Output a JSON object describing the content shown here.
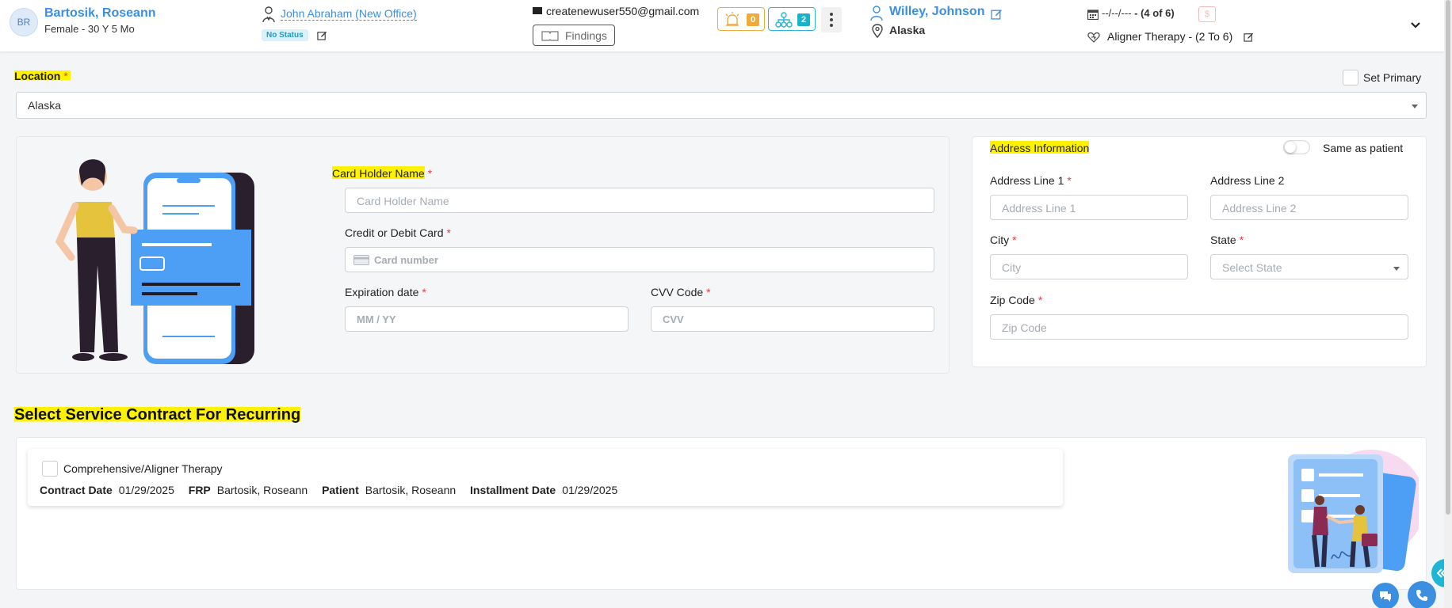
{
  "patient": {
    "initials": "BR",
    "name": "Bartosik, Roseann",
    "info": "Female - 30 Y 5 Mo"
  },
  "doctor": {
    "name": "John Abraham (New Office)",
    "status": "No Status"
  },
  "contact": {
    "email": "createnewuser550@gmail.com",
    "findings_label": "Findings"
  },
  "counters": {
    "alerts": "0",
    "family": "2"
  },
  "provider": {
    "name": "Willey, Johnson",
    "location": "Alaska"
  },
  "appointment": {
    "date": "--/--/---",
    "count": " - (4 of 6)",
    "dollar": "$",
    "therapy": "Aligner Therapy - (2 To 6)"
  },
  "location_section": {
    "label": "Location",
    "required": "*",
    "set_primary": "Set Primary",
    "selected": "Alaska"
  },
  "card_form": {
    "holder_label": "Card Holder Name",
    "holder_placeholder": "Card Holder Name",
    "card_label": "Credit or Debit Card",
    "card_placeholder": "Card number",
    "exp_label": "Expiration date",
    "exp_placeholder": "MM / YY",
    "cvv_label": "CVV Code",
    "cvv_placeholder": "CVV",
    "required": "*"
  },
  "address": {
    "title": "Address Information",
    "same_as_patient": "Same as patient",
    "line1_label": "Address Line 1",
    "line1_placeholder": "Address Line 1",
    "line2_label": "Address Line 2",
    "line2_placeholder": "Address Line 2",
    "city_label": "City",
    "city_placeholder": "City",
    "state_label": "State",
    "state_placeholder": "Select State",
    "zip_label": "Zip Code",
    "zip_placeholder": "Zip Code",
    "required": "*"
  },
  "contracts": {
    "title": "Select Service Contract For Recurring",
    "items": [
      {
        "name": "Comprehensive/Aligner Therapy",
        "contract_date_label": "Contract Date",
        "contract_date": "01/29/2025",
        "frp_label": "FRP",
        "frp": "Bartosik, Roseann",
        "patient_label": "Patient",
        "patient": "Bartosik, Roseann",
        "installment_label": "Installment Date",
        "installment_date": "01/29/2025"
      }
    ]
  },
  "colors": {
    "accent": "#3b8fe0",
    "highlight": "#fff200",
    "required": "#e53e3e",
    "alert": "#f0a93b",
    "teal": "#18b3c7"
  }
}
